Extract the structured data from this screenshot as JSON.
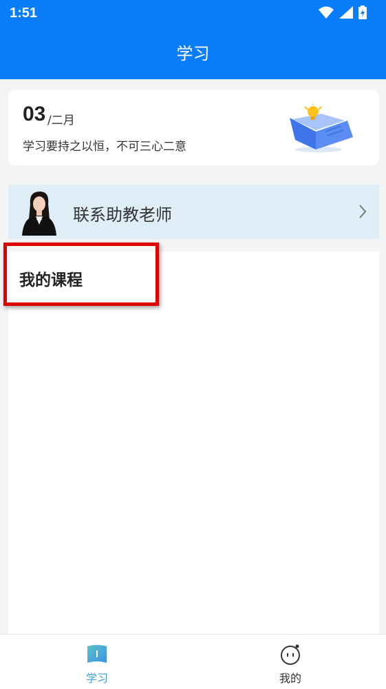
{
  "status_bar": {
    "time": "1:51"
  },
  "header": {
    "title": "学习"
  },
  "date_card": {
    "day": "03",
    "month": "/二月",
    "motto": "学习要持之以恒，不可三心二意"
  },
  "teacher": {
    "label": "联系助教老师"
  },
  "courses": {
    "title": "我的课程"
  },
  "tabbar": {
    "tabs": [
      {
        "label": "学习",
        "active": true
      },
      {
        "label": "我的",
        "active": false
      }
    ]
  },
  "colors": {
    "primary": "#0a7dfa",
    "active_tab": "#3ea2dd",
    "highlight": "#e00000"
  }
}
